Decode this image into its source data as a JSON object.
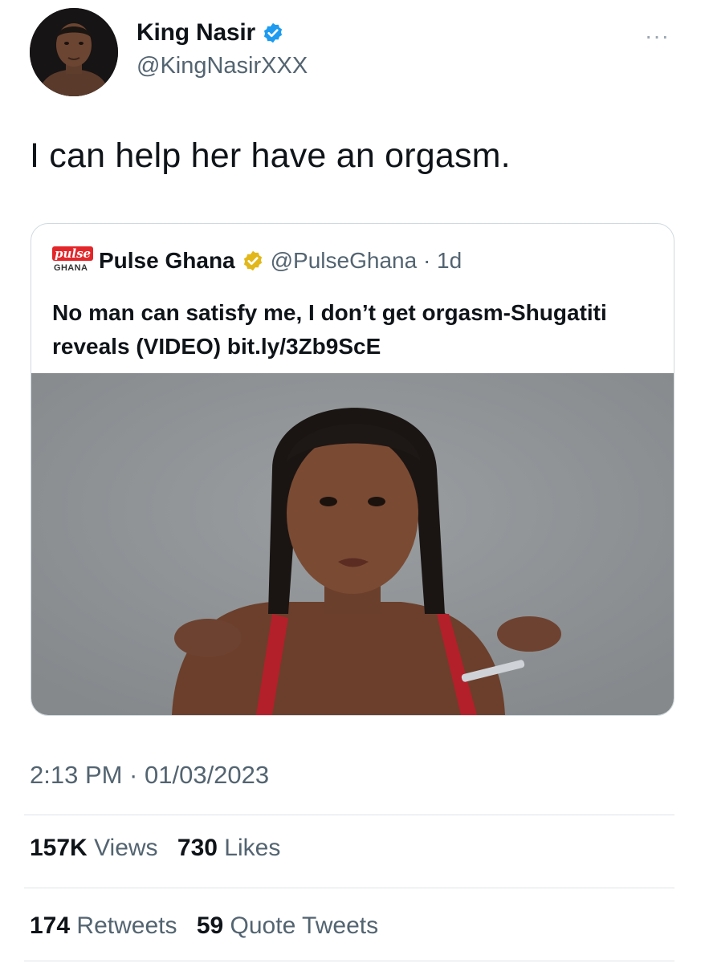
{
  "author": {
    "display_name": "King Nasir",
    "handle": "@KingNasirXXX",
    "verified_color": "#1d9bf0"
  },
  "more_icon": "···",
  "tweet_text": "I can help her have an orgasm.",
  "quoted": {
    "logo_word": "pulse",
    "logo_sub": "GHANA",
    "name": "Pulse Ghana",
    "handle_time": "@PulseGhana · 1d",
    "verified_color": "#e2b719",
    "text": "No man can satisfy me, I don’t get orgasm-Shugatiti reveals (VIDEO) bit.ly/3Zb9ScE",
    "image_alt": "Photo of a woman with braided hair against a grey background"
  },
  "timestamp": "2:13 PM · 01/03/2023",
  "stats": {
    "views_count": "157K",
    "views_label": "Views",
    "likes_count": "730",
    "likes_label": "Likes",
    "retweets_count": "174",
    "retweets_label": "Retweets",
    "quotes_count": "59",
    "quotes_label": "Quote Tweets"
  }
}
